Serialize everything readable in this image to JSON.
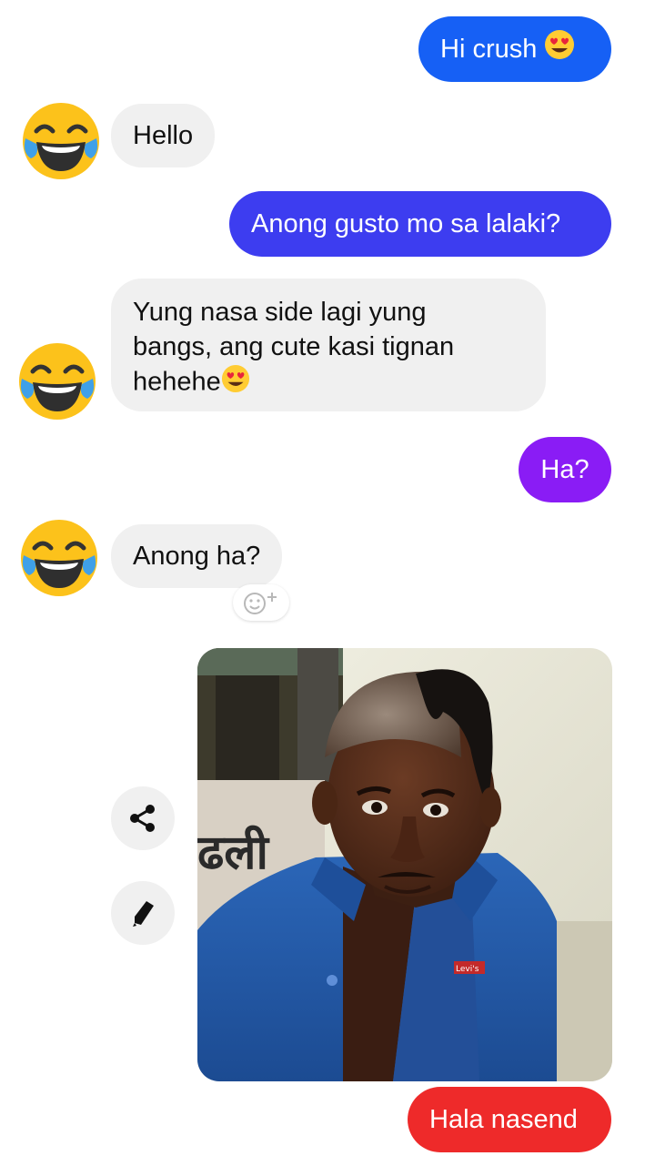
{
  "messages": {
    "m1": {
      "text": "Hi crush",
      "emoji": "heart-eyes"
    },
    "m2": {
      "text": "Hello"
    },
    "m3": {
      "text": "Anong gusto mo sa lalaki?"
    },
    "m4": {
      "line1": "Yung nasa side lagi yung",
      "line2": "bangs, ang cute kasi tignan",
      "line3": "hehehe",
      "emoji": "heart-eyes"
    },
    "m5": {
      "text": "Ha?"
    },
    "m6": {
      "text": "Anong ha?"
    },
    "m7": {
      "text": "Hala nasend"
    }
  },
  "photo": {
    "sign_text": "ढली",
    "shirt_label": "Levi's"
  },
  "icons": {
    "avatar": "laughing-tears-emoji",
    "reaction": "add-reaction-icon",
    "share": "share-icon",
    "edit": "pencil-icon"
  },
  "colors": {
    "blue": "#0a67ff",
    "indigo": "#3d3df0",
    "violet": "#8a1cf5",
    "red": "#ee2a2a",
    "incoming": "#f0f0f0"
  }
}
